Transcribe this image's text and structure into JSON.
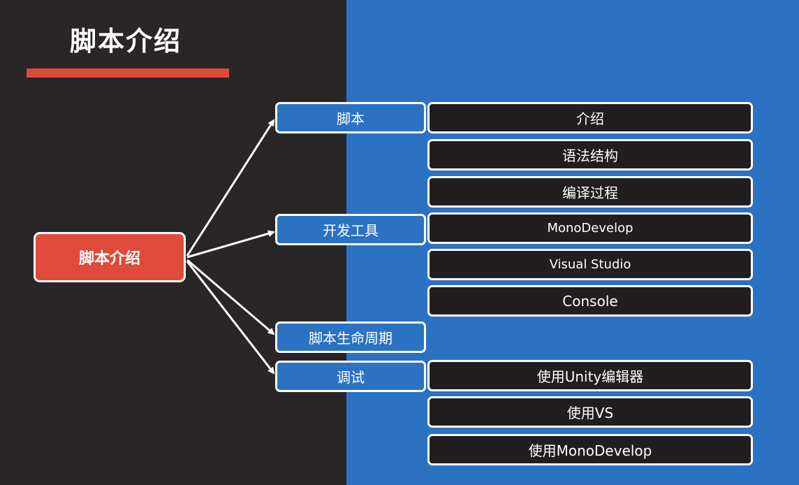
{
  "slide": {
    "title": "脚本介绍",
    "colors": {
      "background": "#2a2526",
      "accent_panel": "#2b72c2",
      "accent_red": "#e04a3a",
      "leaf_fill": "#221e1f",
      "border": "#ffffff"
    }
  },
  "diagram": {
    "root": "脚本介绍",
    "categories": [
      {
        "label": "脚本",
        "children": [
          "介绍",
          "语法结构",
          "编译过程"
        ]
      },
      {
        "label": "开发工具",
        "children": [
          "MonoDevelop",
          "Visual Studio",
          "Console"
        ]
      },
      {
        "label": "脚本生命周期",
        "children": []
      },
      {
        "label": "调试",
        "children": [
          "使用Unity编辑器",
          "使用VS",
          "使用MonoDevelop"
        ]
      }
    ]
  }
}
